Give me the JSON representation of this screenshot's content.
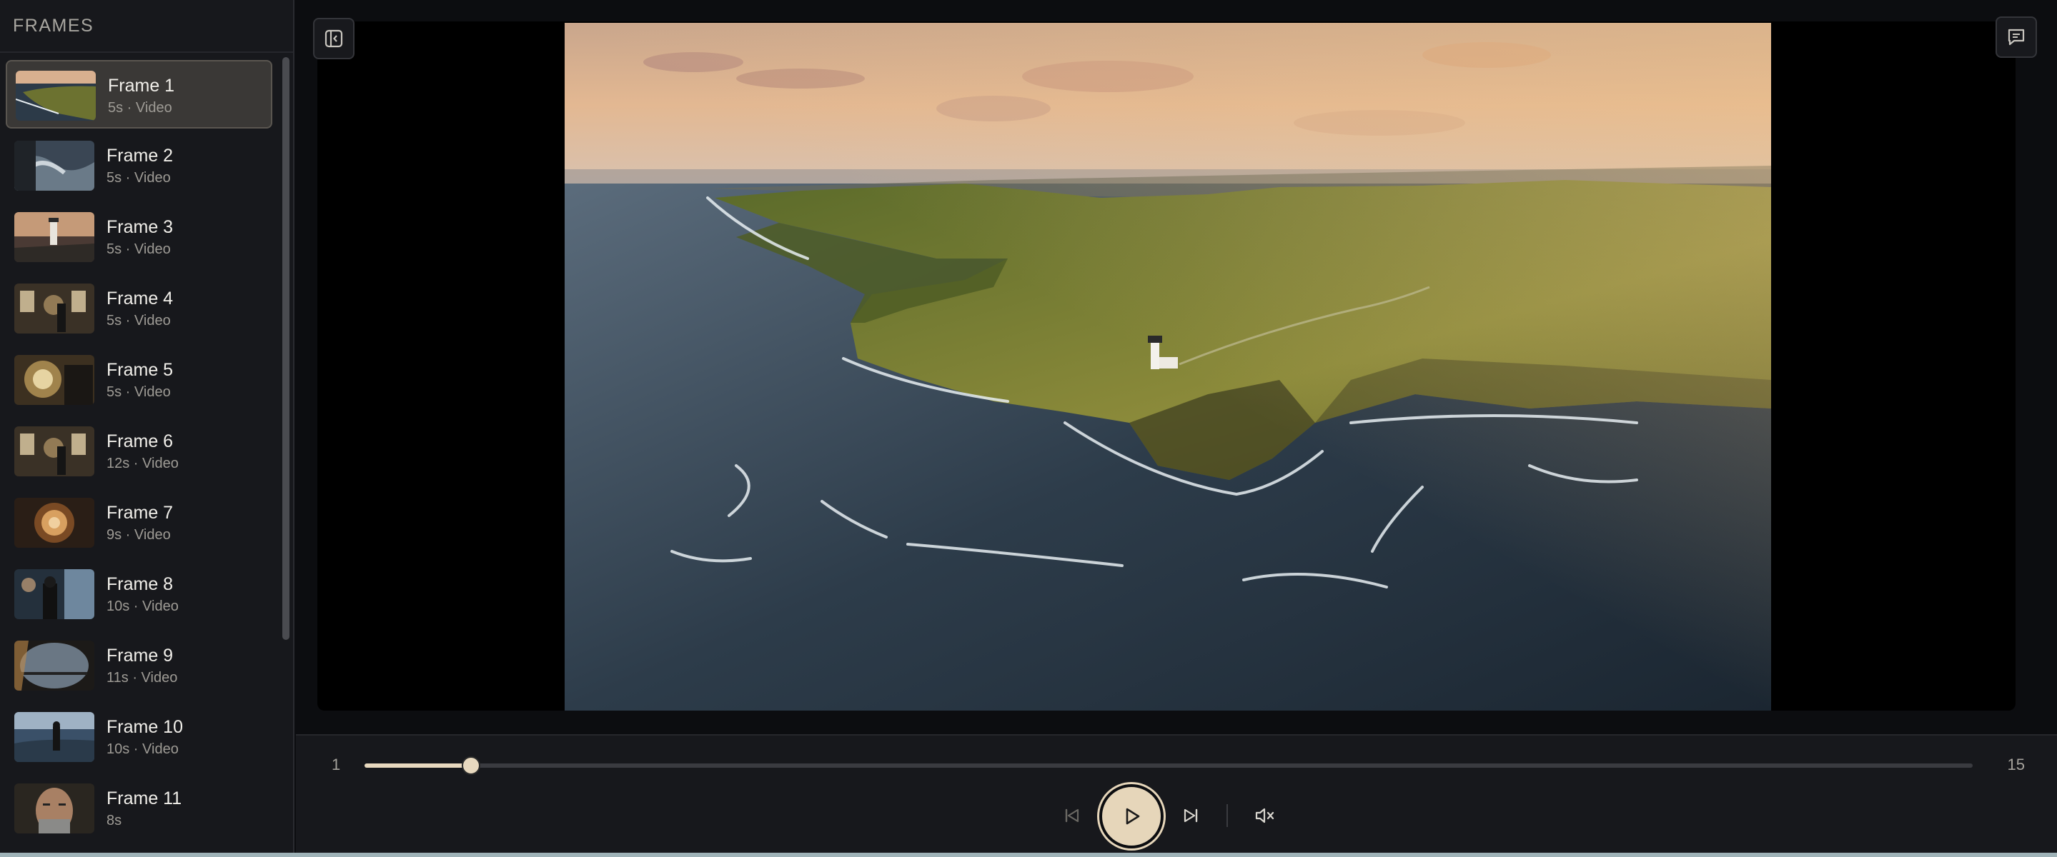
{
  "sidebar": {
    "title": "FRAMES",
    "items": [
      {
        "title": "Frame 1",
        "meta": "5s · Video",
        "selected": true,
        "thumb": "coast-aerial"
      },
      {
        "title": "Frame 2",
        "meta": "5s · Video",
        "selected": false,
        "thumb": "waves"
      },
      {
        "title": "Frame 3",
        "meta": "5s · Video",
        "selected": false,
        "thumb": "lighthouse"
      },
      {
        "title": "Frame 4",
        "meta": "5s · Video",
        "selected": false,
        "thumb": "interior"
      },
      {
        "title": "Frame 5",
        "meta": "5s · Video",
        "selected": false,
        "thumb": "lamp"
      },
      {
        "title": "Frame 6",
        "meta": "12s · Video",
        "selected": false,
        "thumb": "interior"
      },
      {
        "title": "Frame 7",
        "meta": "9s · Video",
        "selected": false,
        "thumb": "lens"
      },
      {
        "title": "Frame 8",
        "meta": "10s · Video",
        "selected": false,
        "thumb": "man-window"
      },
      {
        "title": "Frame 9",
        "meta": "11s · Video",
        "selected": false,
        "thumb": "storm-window"
      },
      {
        "title": "Frame 10",
        "meta": "10s · Video",
        "selected": false,
        "thumb": "figure-sea"
      },
      {
        "title": "Frame 11",
        "meta": "8s",
        "selected": false,
        "thumb": "portrait"
      }
    ]
  },
  "toolbar": {
    "toggle_sidebar_icon": "sidebar-toggle-icon",
    "comments_icon": "comment-icon"
  },
  "timeline": {
    "start_label": "1",
    "end_label": "15",
    "progress": 0.066
  },
  "transport": {
    "prev_icon": "skip-back-icon",
    "play_icon": "play-icon",
    "next_icon": "skip-forward-icon",
    "mute_icon": "mute-icon"
  },
  "colors": {
    "accent": "#e6d6ba",
    "background": "#0c0d10",
    "panel": "#17181c"
  }
}
